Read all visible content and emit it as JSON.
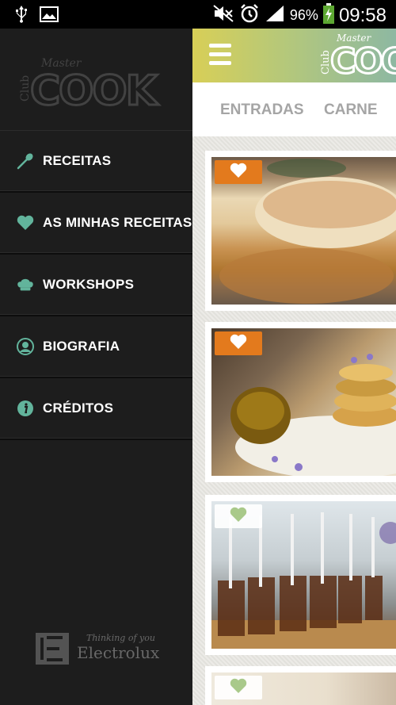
{
  "status_bar": {
    "battery_percent": "96%",
    "time": "09:58",
    "icons": [
      "usb-icon",
      "image-notification-icon",
      "mute-icon",
      "alarm-icon",
      "signal-icon",
      "battery-charging-icon"
    ]
  },
  "drawer": {
    "logo": {
      "top_text": "Master",
      "side_text": "Club",
      "main_text": "COOK"
    },
    "items": [
      {
        "label": "RECEITAS",
        "icon": "spoon-icon"
      },
      {
        "label": "AS MINHAS RECEITAS",
        "icon": "heart-icon"
      },
      {
        "label": "WORKSHOPS",
        "icon": "chef-hat-icon"
      },
      {
        "label": "BIOGRAFIA",
        "icon": "person-icon"
      },
      {
        "label": "CRÉDITOS",
        "icon": "info-icon"
      }
    ],
    "brand": {
      "tagline": "Thinking of you",
      "name": "Electrolux"
    }
  },
  "header": {
    "menu_icon": "hamburger-icon",
    "logo": {
      "top_text": "Master",
      "side_text": "Club",
      "main_text": "COOK"
    }
  },
  "tabs": [
    "ENTRADAS",
    "CARNE"
  ],
  "recipes": [
    {
      "favorite": true,
      "icon": "heart-icon"
    },
    {
      "favorite": true,
      "icon": "heart-icon"
    },
    {
      "favorite": false,
      "icon": "heart-icon"
    },
    {
      "favorite": false,
      "icon": "heart-icon"
    }
  ],
  "colors": {
    "accent_green": "#62b49c",
    "favorite_orange": "#e37a1d",
    "favorite_off": "#a9c98a",
    "drawer_bg": "#1d1d1d"
  }
}
